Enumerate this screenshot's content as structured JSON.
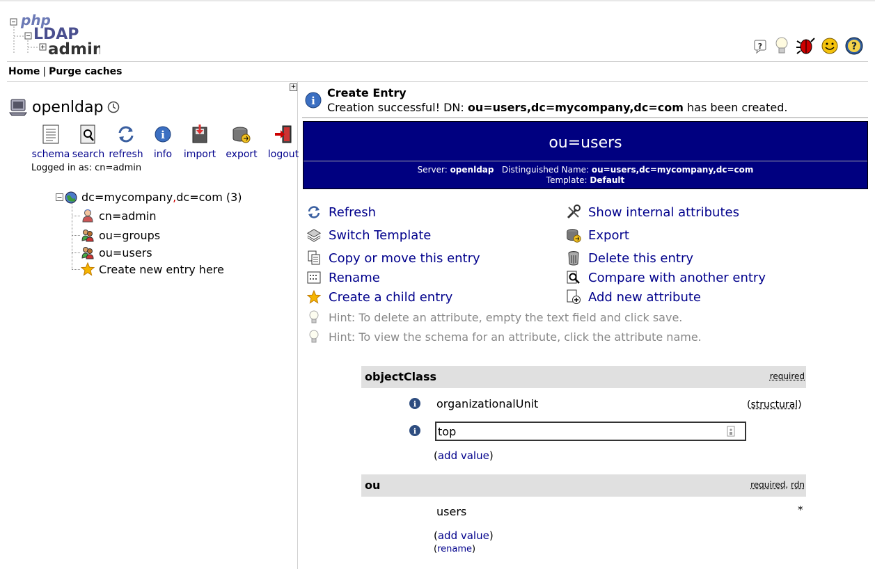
{
  "app": {
    "logo_text": "phpLDAPadmin"
  },
  "header": {
    "icons": [
      "help-icon",
      "hint-icon",
      "bug-icon",
      "donate-icon",
      "about-icon"
    ]
  },
  "topnav": {
    "home": "Home",
    "separator": "|",
    "purge": "Purge caches"
  },
  "left": {
    "collapse": "+",
    "server_name": "openldap",
    "tools": [
      {
        "label": "schema",
        "icon": "schema-icon"
      },
      {
        "label": "search",
        "icon": "search-icon"
      },
      {
        "label": "refresh",
        "icon": "refresh-icon"
      },
      {
        "label": "info",
        "icon": "info-icon"
      },
      {
        "label": "import",
        "icon": "import-icon"
      },
      {
        "label": "export",
        "icon": "export-icon"
      },
      {
        "label": "logout",
        "icon": "logout-icon"
      }
    ],
    "logged_in": "Logged in as: cn=admin",
    "tree": {
      "root_part1": "dc=mycompany",
      "root_comma": ",",
      "root_part2": "dc=com (3)",
      "children": [
        "cn=admin",
        "ou=groups",
        "ou=users"
      ],
      "create": "Create new entry here"
    }
  },
  "message": {
    "title": "Create Entry",
    "body_prefix": "Creation successful! DN: ",
    "dn": "ou=users,dc=mycompany,dc=com",
    "body_suffix": " has been created."
  },
  "banner": {
    "title": "ou=users",
    "server_label": "Server: ",
    "server": "openldap",
    "dn_label": "Distinguished Name: ",
    "dn": "ou=users,dc=mycompany,dc=com",
    "template_label": "Template: ",
    "template": "Default"
  },
  "actions": {
    "refresh": "Refresh",
    "switch_template": "Switch Template",
    "copy_move": "Copy or move this entry",
    "rename": "Rename",
    "create_child": "Create a child entry",
    "show_internal": "Show internal attributes",
    "export": "Export",
    "delete": "Delete this entry",
    "compare": "Compare with another entry",
    "add_attribute": "Add new attribute",
    "hint1": "Hint: To delete an attribute, empty the text field and click save.",
    "hint2": "Hint: To view the schema for an attribute, click the attribute name."
  },
  "attributes": {
    "objectclass": {
      "name": "objectClass",
      "flags": "required",
      "values": [
        "organizationalUnit",
        "top"
      ],
      "structural_open": "(",
      "structural": "structural",
      "structural_close": ")",
      "add_value_open": "(",
      "add_value": "add value",
      "add_value_close": ")"
    },
    "ou": {
      "name": "ou",
      "flag_required": "required",
      "flag_sep": ", ",
      "flag_rdn": "rdn",
      "value": "users",
      "star": "*",
      "add_value_open": "(",
      "add_value": "add value",
      "add_value_close": ")",
      "rename_open": "(",
      "rename": "rename",
      "rename_close": ")"
    }
  }
}
